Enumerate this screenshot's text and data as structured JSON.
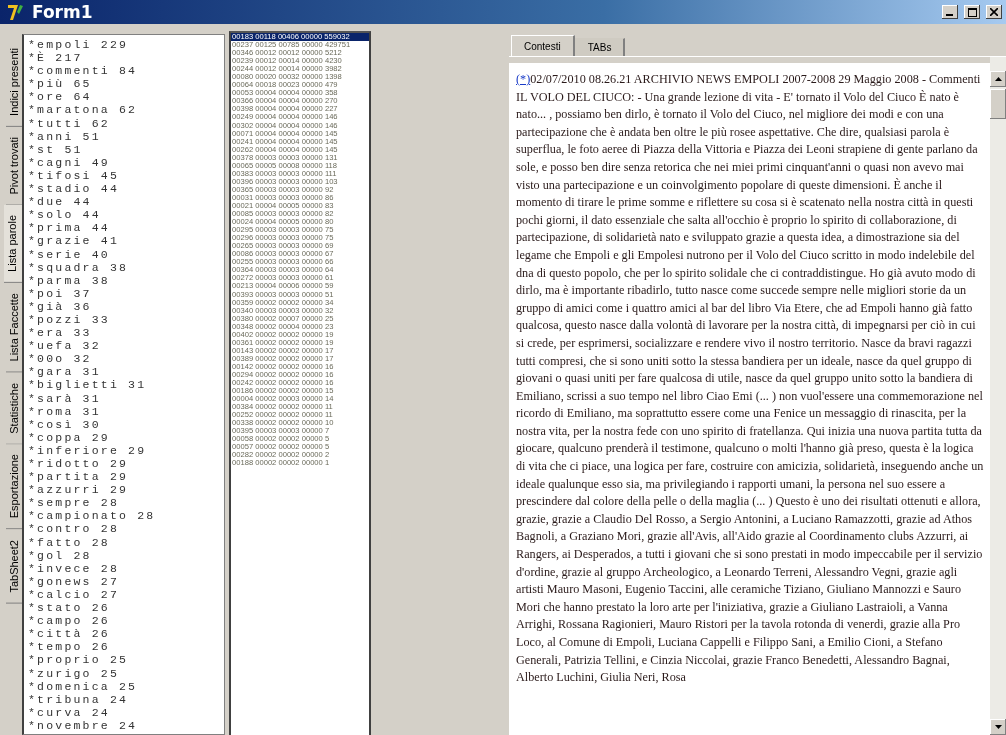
{
  "window": {
    "title": "Form1"
  },
  "side_tabs": [
    {
      "label": "Indici presenti",
      "selected": false
    },
    {
      "label": "Pivot trovati",
      "selected": false
    },
    {
      "label": "Lista parole",
      "selected": true
    },
    {
      "label": "Lista Faccette",
      "selected": false
    },
    {
      "label": "Statistiche",
      "selected": false
    },
    {
      "label": "Esportazione",
      "selected": false
    },
    {
      "label": "TabSheet2",
      "selected": false
    }
  ],
  "word_list": [
    "*empoli 229",
    "*È 217",
    "*commenti 84",
    "*più 65",
    "*ore 64",
    "*maratona 62",
    "*tutti 62",
    "*anni 51",
    "*st 51",
    "*cagni 49",
    "*tifosi 45",
    "*stadio 44",
    "*due 44",
    "*solo 44",
    "*prima 44",
    "*grazie 41",
    "*serie 40",
    "*squadra 38",
    "*parma 38",
    "*poi 37",
    "*già 36",
    "*pozzi 33",
    "*era 33",
    "*uefa 32",
    "*00o 32",
    "*gara 31",
    "*biglietti 31",
    "*sarà 31",
    "*roma 31",
    "*così 30",
    "*coppa 29",
    "*inferiore 29",
    "*ridotto 29",
    "*partita 29",
    "*azzurri 29",
    "*sempre 28",
    "*campionato 28",
    "*contro 28",
    "*fatto 28",
    "*gol 28",
    "*invece 28",
    "*gonews 27",
    "*calcio 27",
    "*stato 26",
    "*campo 26",
    "*città 26",
    "*tempo 26",
    "*proprio 25",
    "*zurigo 25",
    "*domenica 25",
    "*tribuna 24",
    "*curva 24",
    "*novembre 24"
  ],
  "pivot_list": [
    {
      "text": "00183 00118 00406 00000 559032",
      "selected": true
    },
    {
      "text": "00237 00125 00785 00000 429751",
      "selected": false
    },
    {
      "text": "00346 00012 00012 00000 5212",
      "selected": false
    },
    {
      "text": "00239 00012 00014 00000 4230",
      "selected": false
    },
    {
      "text": "00244 00012 00014 00000 3982",
      "selected": false
    },
    {
      "text": "00080 00020 00032 00000 1398",
      "selected": false
    },
    {
      "text": "00064 00018 00023 00000 479",
      "selected": false
    },
    {
      "text": "00053 00004 00004 00000 358",
      "selected": false
    },
    {
      "text": "00366 00004 00004 00000 270",
      "selected": false
    },
    {
      "text": "00398 00004 00004 00000 227",
      "selected": false
    },
    {
      "text": "00249 00004 00004 00000 146",
      "selected": false
    },
    {
      "text": "00302 00004 00004 00000 146",
      "selected": false
    },
    {
      "text": "00071 00004 00004 00000 145",
      "selected": false
    },
    {
      "text": "00241 00004 00004 00000 145",
      "selected": false
    },
    {
      "text": "00262 00004 00004 00000 145",
      "selected": false
    },
    {
      "text": "00378 00003 00003 00000 131",
      "selected": false
    },
    {
      "text": "00065 00005 00008 00000 118",
      "selected": false
    },
    {
      "text": "00383 00003 00003 00000 111",
      "selected": false
    },
    {
      "text": "00396 00003 00003 00000 103",
      "selected": false
    },
    {
      "text": "00365 00003 00003 00000 92",
      "selected": false
    },
    {
      "text": "00031 00003 00003 00000 86",
      "selected": false
    },
    {
      "text": "00021 00004 00005 00000 83",
      "selected": false
    },
    {
      "text": "00085 00003 00003 00000 82",
      "selected": false
    },
    {
      "text": "00024 00004 00005 00000 80",
      "selected": false
    },
    {
      "text": "00295 00003 00003 00000 75",
      "selected": false
    },
    {
      "text": "00296 00003 00003 00000 75",
      "selected": false
    },
    {
      "text": "00265 00003 00003 00000 69",
      "selected": false
    },
    {
      "text": "00086 00003 00003 00000 67",
      "selected": false
    },
    {
      "text": "00255 00003 00003 00000 66",
      "selected": false
    },
    {
      "text": "00364 00003 00003 00000 64",
      "selected": false
    },
    {
      "text": "00272 00003 00003 00000 61",
      "selected": false
    },
    {
      "text": "00213 00004 00006 00000 59",
      "selected": false
    },
    {
      "text": "00393 00003 00003 00000 51",
      "selected": false
    },
    {
      "text": "00359 00002 00002 00000 34",
      "selected": false
    },
    {
      "text": "00340 00003 00003 00000 32",
      "selected": false
    },
    {
      "text": "00380 00002 00007 00000 25",
      "selected": false
    },
    {
      "text": "00348 00002 00004 00000 23",
      "selected": false
    },
    {
      "text": "00402 00002 00002 00000 19",
      "selected": false
    },
    {
      "text": "00361 00002 00002 00000 19",
      "selected": false
    },
    {
      "text": "00143 00002 00002 00000 17",
      "selected": false
    },
    {
      "text": "00389 00002 00002 00000 17",
      "selected": false
    },
    {
      "text": "00142 00002 00002 00000 16",
      "selected": false
    },
    {
      "text": "00294 00002 00002 00000 16",
      "selected": false
    },
    {
      "text": "00242 00002 00002 00000 16",
      "selected": false
    },
    {
      "text": "00186 00002 00002 00000 15",
      "selected": false
    },
    {
      "text": "00004 00002 00003 00000 14",
      "selected": false
    },
    {
      "text": "00384 00002 00002 00000 11",
      "selected": false
    },
    {
      "text": "00252 00002 00002 00000 11",
      "selected": false
    },
    {
      "text": "00338 00002 00002 00000 10",
      "selected": false
    },
    {
      "text": "00395 00003 00003 00000 7",
      "selected": false
    },
    {
      "text": "00058 00002 00002 00000 5",
      "selected": false
    },
    {
      "text": "00057 00002 00002 00000 5",
      "selected": false
    },
    {
      "text": "00282 00002 00002 00000 2",
      "selected": false
    },
    {
      "text": "00188 00002 00002 00000 1",
      "selected": false
    }
  ],
  "content_tabs": [
    {
      "label": "Contesti",
      "selected": true
    },
    {
      "label": "TABs",
      "selected": false
    }
  ],
  "content": {
    "link": "(*)",
    "text": "02/07/2010 08.26.21 ARCHIVIO NEWS EMPOLI 2007-2008 29 Maggio 2008 - Commenti IL VOLO DEL CIUCO: - Una grande lezione di vita - E' tornato il Volo del Ciuco È nato è nato... , possiamo ben dirlo, è tornato il Volo del Ciuco, nel migliore dei modi e con una partecipazione che è andata ben oltre le più rosee aspettative. Che dire, qualsiasi parola è superflua, le foto aeree di Piazza della Vittoria e Piazza dei Leoni strapiene di gente parlano da sole, e posso ben dire senza retorica che nei miei primi cinquant'anni o quasi non avevo mai visto una partecipazione e un coinvolgimento popolare di queste dimensioni. È anche il momento di tirare le prime somme e riflettere su cosa si è scatenato nella nostra città in questi pochi giorni, il dato essenziale che salta all'occhio è proprio lo spirito di collaborazione, di partecipazione, di solidarietà nato e sviluppato grazie a questa idea, a dimostrazione sia del legame che Empoli e gli Empolesi nutrono per il Volo del Ciuco scritto in modo indelebile del dna di questo popolo, che per lo spirito solidale che ci contraddistingue. Ho già avuto modo di dirlo, ma è importante ribadirlo, tutto nasce come succede sempre nelle migliori storie da un gruppo di amici come i quattro amici al bar del libro Via Etere, che ad Empoli hanno già fatto qualcosa, questo nasce dalla volontà di lavorare per la nostra città, di impegnarsi per ciò in cui si crede, per esprimersi, socializzare e rendere vivo il nostro territorio. Nasce da bravi ragazzi tutti compresi, che si sono uniti sotto la stessa bandiera per un ideale, nasce da quel gruppo di giovani o quasi uniti per fare qualcosa di utile, nasce da quel gruppo unito sotto la bandiera di Emiliano, scrissi a suo tempo nel libro Ciao Emi (... ) non vuol'essere una commemorazione nel ricordo di Emiliano, ma soprattutto essere come una Fenice un messaggio di rinascita, per la nostra vita, per la nostra fede con uno spirito di fratellanza. Qui inizia una nuova partita tutta da giocare, qualcuno prenderà il testimone, qualcuno o molti l'hanno già preso, questa è la logica di vita che ci piace, una logica per fare, costruire con amicizia, solidarietà, inseguendo anche un ideale qualunque esso sia, ma privilegiando i rapporti umani, la persona nel suo essere a prescindere dal colore della pelle o della maglia (... ) Questo è uno dei risultati ottenuti e allora, grazie, grazie a Claudio Del Rosso, a Sergio Antonini, a Luciano Ramazzotti, grazie ad Athos Bagnoli, a Graziano Mori, grazie all'Avis, all'Aido grazie al Coordinamento clubs Azzurri, ai Rangers, ai Desperados, a tutti i giovani che si sono prestati in modo impeccabile per il servizio d'ordine, grazie al gruppo Archeologico, a Leonardo Terreni, Alessandro Vegni, grazie agli artisti Mauro Masoni, Eugenio Taccini, alle ceramiche Tiziano, Giuliano Mannozzi e Sauro Mori che hanno prestato la loro arte per l'iniziativa, grazie a Giuliano Lastraioli, a Vanna Arrighi, Rossana Ragionieri, Mauro Ristori per la tavola rotonda di venerdi, grazie alla Pro Loco, al Comune di Empoli, Luciana Cappelli e Filippo Sani, a Emilio Cioni, a Stefano Generali, Patrizia Tellini, e Cinzia Niccolai, grazie Franco Benedetti, Alessandro Bagnai, Alberto Luchini, Giulia Neri, Rosa"
  }
}
